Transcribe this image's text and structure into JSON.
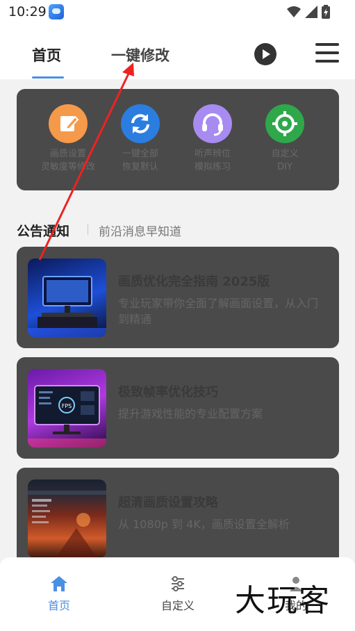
{
  "status": {
    "time": "10:29"
  },
  "header": {
    "tabs": [
      {
        "label": "首页"
      },
      {
        "label": "一键修改"
      }
    ],
    "active_color": "#4a90e2"
  },
  "quick_actions": [
    {
      "icon": "edit-icon",
      "line1": "画质设置",
      "line2": "灵敏度等修改",
      "color": "#f59a4a"
    },
    {
      "icon": "refresh-icon",
      "line1": "一键全部",
      "line2": "恢复默认",
      "color": "#2b7de0"
    },
    {
      "icon": "headset-icon",
      "line1": "听声辨位",
      "line2": "模拟练习",
      "color": "#a78bf0"
    },
    {
      "icon": "crosshair-icon",
      "line1": "自定义",
      "line2": "DIY",
      "color": "#2ea84a"
    }
  ],
  "notice": {
    "title": "公告通知",
    "subtitle": "前沿消息早知道"
  },
  "articles": [
    {
      "title": "画质优化完全指南 2025版",
      "desc": "专业玩家带你全面了解画面设置，从入门到精通"
    },
    {
      "title": "极致帧率优化技巧",
      "desc": "提升游戏性能的专业配置方案"
    },
    {
      "title": "超清画质设置攻略",
      "desc": "从 1080p 到 4K，画质设置全解析"
    }
  ],
  "bottom_nav": [
    {
      "label": "首页",
      "icon": "home-icon"
    },
    {
      "label": "自定义",
      "icon": "sliders-icon"
    },
    {
      "label": "我的",
      "icon": "user-icon"
    }
  ],
  "watermark": "大玩客"
}
